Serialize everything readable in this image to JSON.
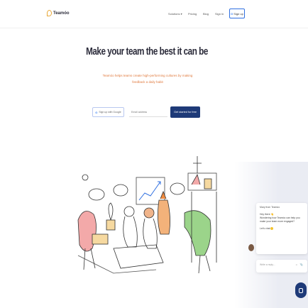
{
  "header": {
    "logo_text": "Teamóo",
    "nav": [
      {
        "label": "Solutions",
        "has_caret": true
      },
      {
        "label": "Pricing"
      },
      {
        "label": "Blog"
      },
      {
        "label": "Sign in"
      }
    ],
    "signup_label": "Sign up"
  },
  "hero": {
    "title": "Make your team the best it can be",
    "subtitle_line1": "Teamóo helps teams create high-performing cultures by making",
    "subtitle_line2": "feedback a daily habit"
  },
  "form": {
    "google_label": "Sign up with Google",
    "email_placeholder": "Email address",
    "cta_label": "Get started for free"
  },
  "chat": {
    "from": "Mary from Teamóo",
    "lines": [
      "Hey there 👋",
      "Wondering how Teamóo can help you",
      "make your team more engaged?"
    ],
    "sign": "Let's chat",
    "reply_placeholder": "Write a reply...",
    "reply_icons": "☺ 📎"
  },
  "colors": {
    "accent": "#1e3a78",
    "logo": "#e8a93a",
    "subtitle": "#e07a3e"
  }
}
